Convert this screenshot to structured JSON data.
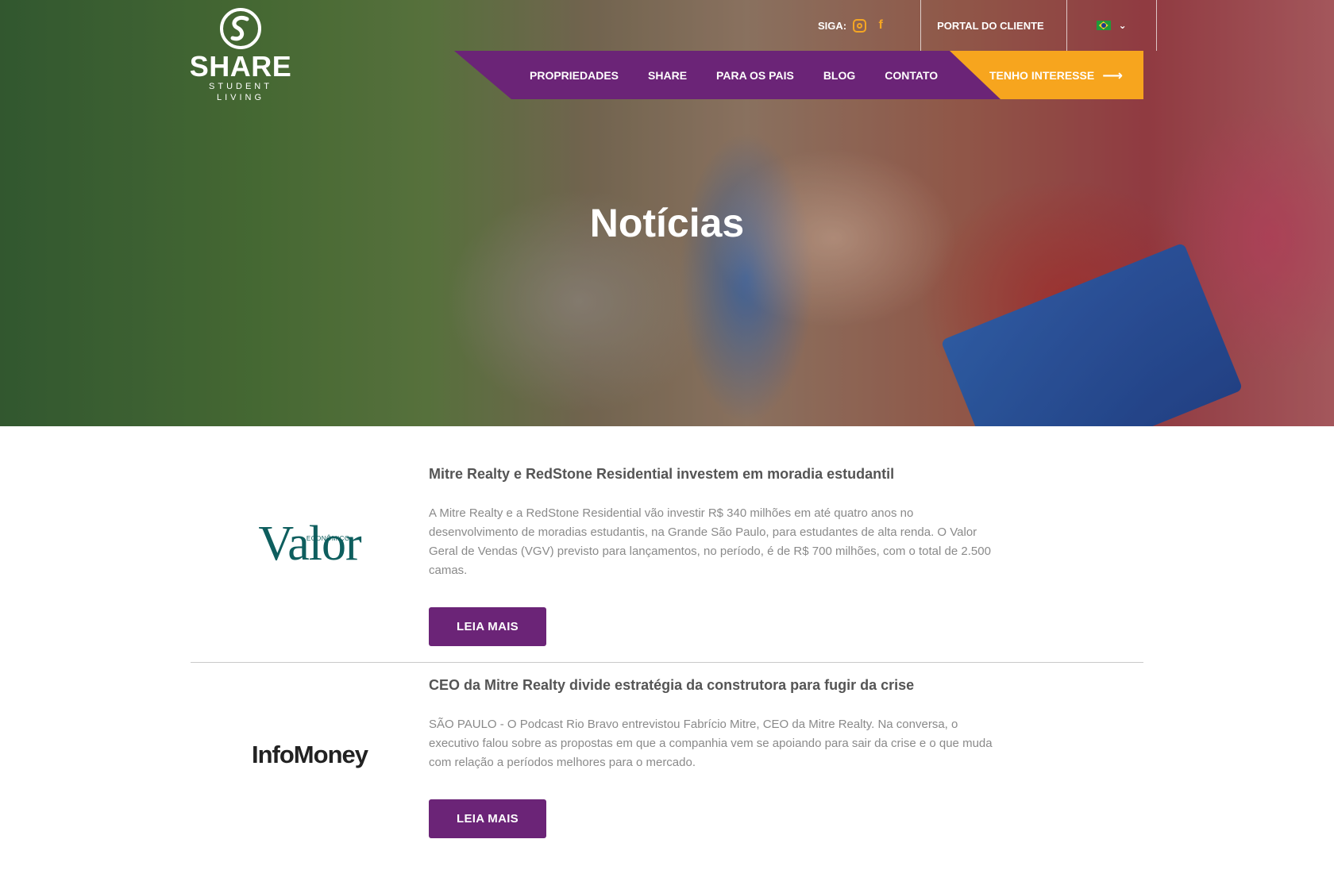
{
  "header": {
    "logo_word": "SHARE",
    "logo_sub": "STUDENT LIVING",
    "follow_label": "SIGA:",
    "social": [
      "instagram-icon",
      "facebook-icon"
    ],
    "portal_label": "PORTAL DO CLIENTE",
    "language_flag": "brazil-flag",
    "nav": [
      "PROPRIEDADES",
      "SHARE",
      "PARA OS PAIS",
      "BLOG",
      "CONTATO"
    ],
    "cta_label": "TENHO INTERESSE"
  },
  "hero": {
    "title": "Notícias"
  },
  "news": [
    {
      "source": "Valor",
      "source_sub": "ECONÔMICO",
      "title": "Mitre Realty e RedStone Residential investem em moradia estudantil",
      "text": "A Mitre Realty e a RedStone Residential vão investir R$ 340 milhões em até quatro anos no desenvolvimento de moradias estudantis, na Grande São Paulo, para estudantes de alta renda. O Valor Geral de Vendas (VGV) previsto para lançamentos, no período, é de R$ 700 milhões, com o total de 2.500 camas.",
      "button": "LEIA MAIS"
    },
    {
      "source": "InfoMoney",
      "title": "CEO da Mitre Realty divide estratégia da construtora para fugir da crise",
      "text": "SÃO PAULO - O Podcast Rio Bravo entrevistou Fabrício Mitre, CEO da Mitre Realty. Na conversa, o executivo falou sobre as propostas em que a companhia vem se apoiando para sair da crise e o que muda com relação a períodos melhores para o mercado.",
      "button": "LEIA MAIS"
    }
  ],
  "colors": {
    "purple": "#6b2477",
    "orange": "#f7a51e",
    "valor_teal": "#0e5e5e"
  }
}
